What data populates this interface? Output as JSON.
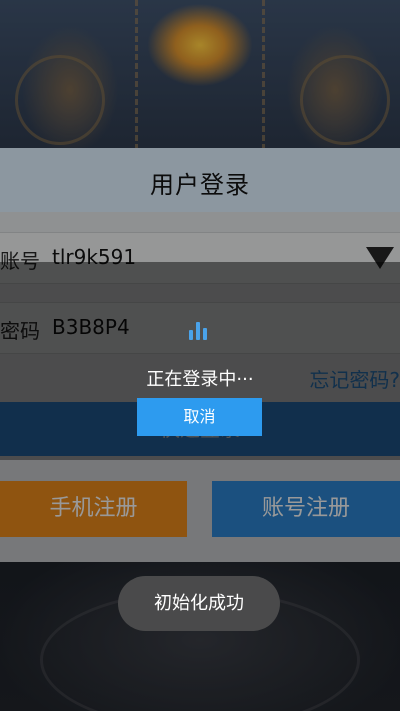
{
  "dialog": {
    "title": "用户登录",
    "account_label": "账号",
    "account_value": "tlr9k591",
    "password_label": "密码",
    "password_value": "B3B8P4",
    "forgot_password": "忘记密码?",
    "login_button": "快速登录",
    "phone_register": "手机注册",
    "account_register": "账号注册"
  },
  "loading": {
    "message": "正在登录中···",
    "cancel_label": "取消",
    "spinner_icon": "loading-bars-icon"
  },
  "toast": {
    "message": "初始化成功"
  },
  "colors": {
    "header": "#c2d1de",
    "login_button": "#2d7dc7",
    "phone_register": "#ef8c1c",
    "account_register": "#2e86d4",
    "cancel_button": "#2d9bef",
    "forgot_link": "#2f7fc9"
  }
}
